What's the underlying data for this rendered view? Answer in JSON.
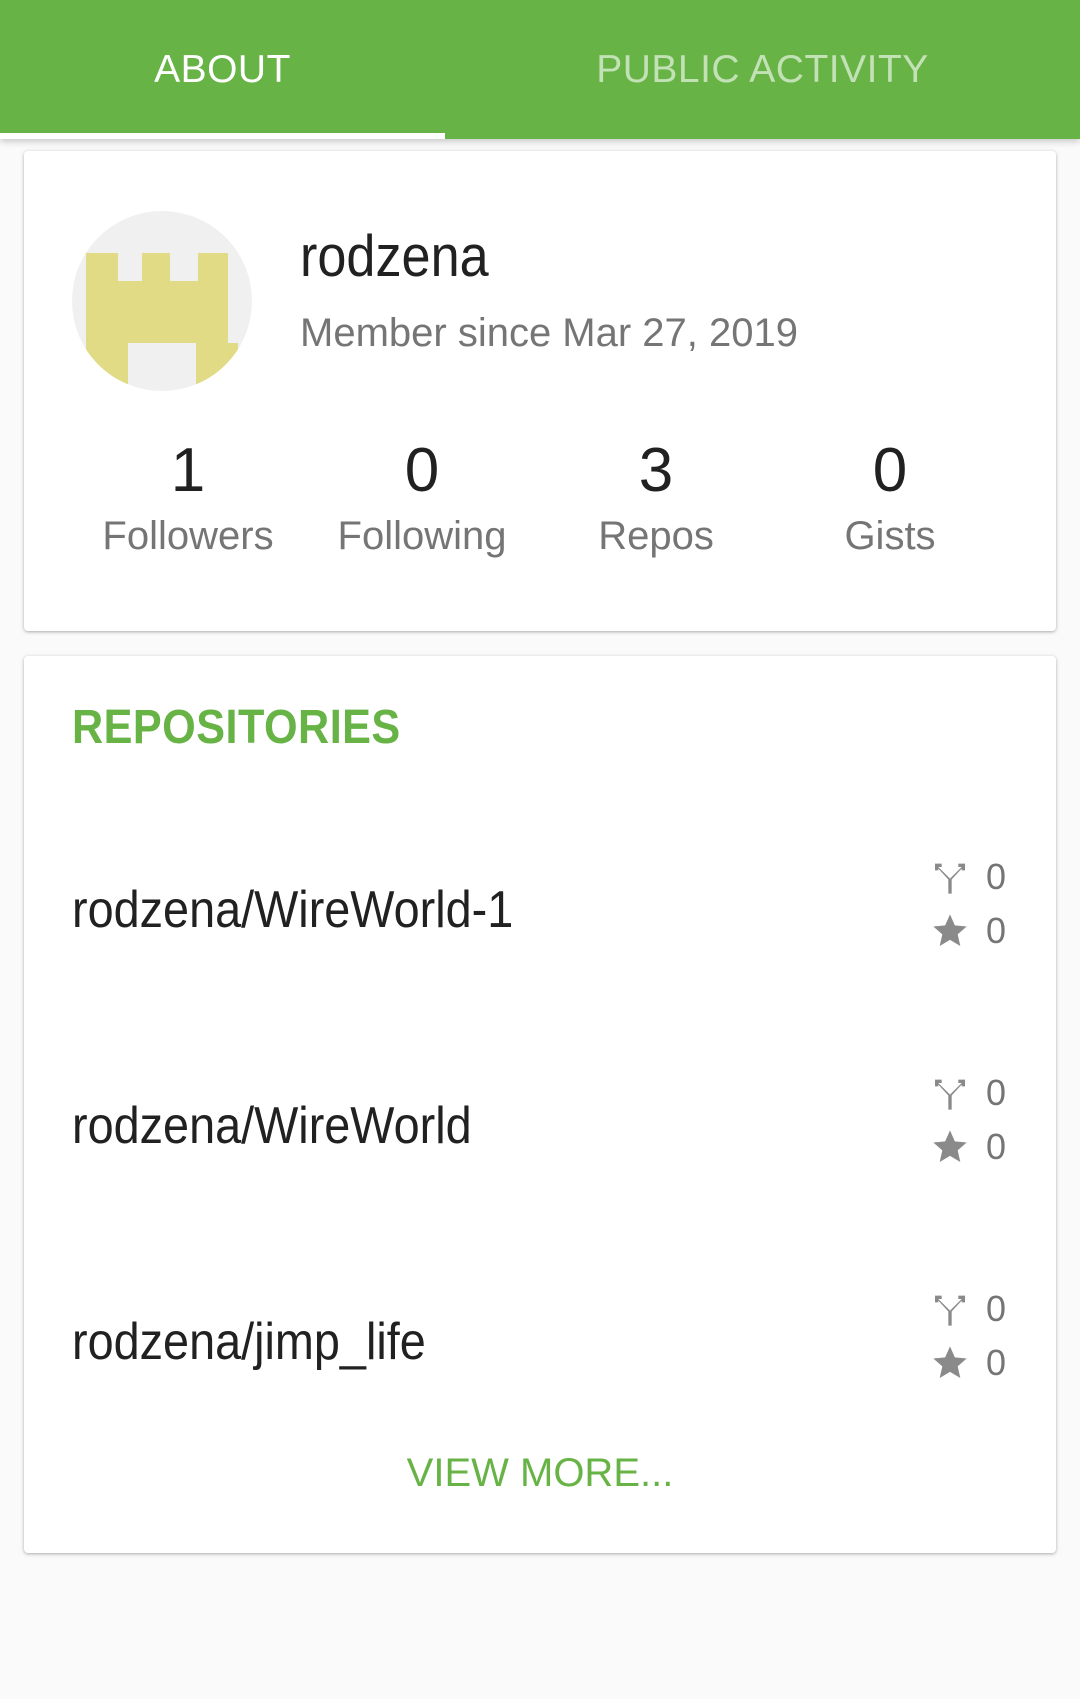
{
  "tabs": [
    {
      "label": "ABOUT",
      "selected": true
    },
    {
      "label": "PUBLIC ACTIVITY",
      "selected": false
    }
  ],
  "profile": {
    "username": "rodzena",
    "member_since": "Member since Mar 27, 2019",
    "avatar": "identicon-avatar",
    "stats": [
      {
        "value": "1",
        "label": "Followers"
      },
      {
        "value": "0",
        "label": "Following"
      },
      {
        "value": "3",
        "label": "Repos"
      },
      {
        "value": "0",
        "label": "Gists"
      }
    ]
  },
  "repositories": {
    "title": "REPOSITORIES",
    "items": [
      {
        "name": "rodzena/WireWorld-1",
        "forks": "0",
        "stars": "0"
      },
      {
        "name": "rodzena/WireWorld",
        "forks": "0",
        "stars": "0"
      },
      {
        "name": "rodzena/jimp_life",
        "forks": "0",
        "stars": "0"
      }
    ],
    "view_more": "VIEW MORE..."
  },
  "colors": {
    "accent": "#67b346",
    "avatar_fill": "#e0db84",
    "icon_gray": "#8a8a8a"
  },
  "icons": {
    "fork": "fork-icon",
    "star": "star-icon"
  }
}
